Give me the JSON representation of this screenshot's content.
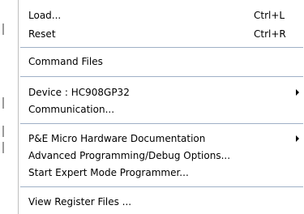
{
  "menu": {
    "items": [
      {
        "label": "Load...",
        "shortcut": "Ctrl+L"
      },
      {
        "label": "Reset",
        "shortcut": "Ctrl+R"
      },
      {
        "label": "Command Files"
      },
      {
        "label": "Device : HC908GP32"
      },
      {
        "label": "Communication..."
      },
      {
        "label": "P&E Micro Hardware Documentation"
      },
      {
        "label": "Advanced Programming/Debug Options..."
      },
      {
        "label": "Start Expert Mode Programmer..."
      },
      {
        "label": "View Register Files ..."
      }
    ]
  }
}
